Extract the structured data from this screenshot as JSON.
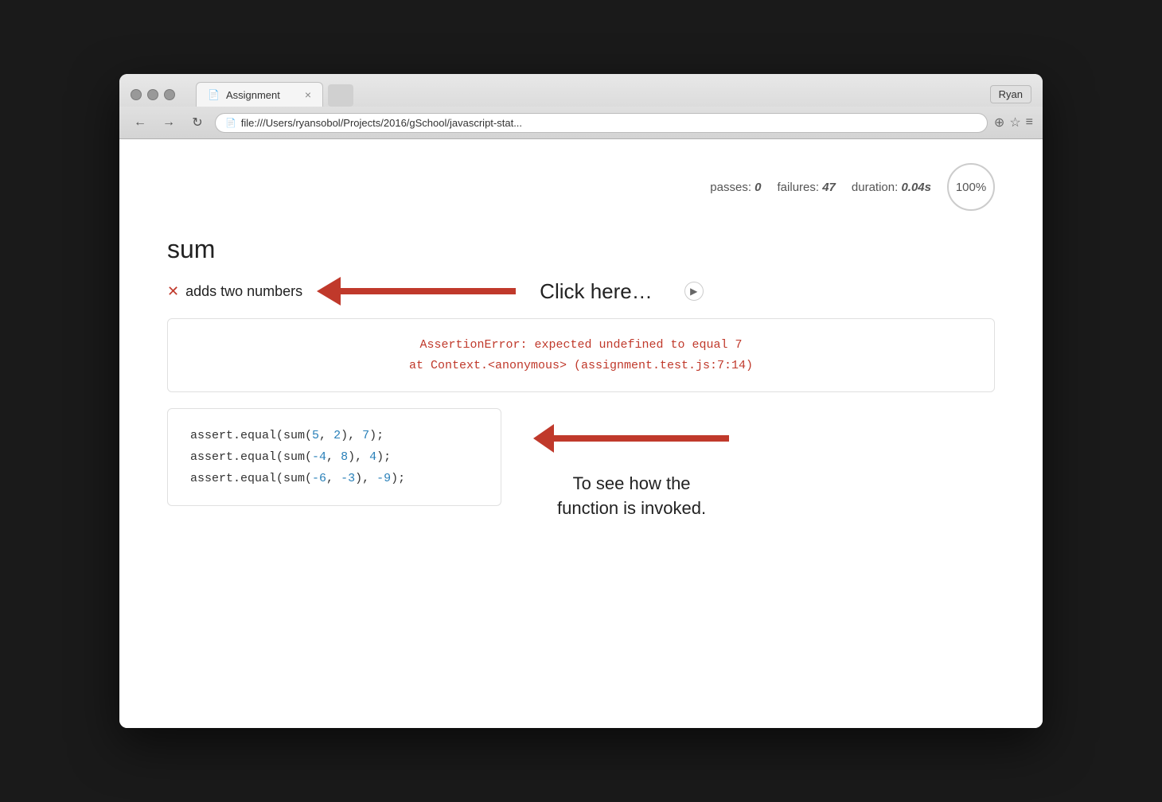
{
  "browser": {
    "tab_label": "Assignment",
    "tab_icon": "📄",
    "tab_close": "×",
    "new_tab_placeholder": "",
    "user_label": "Ryan",
    "back_icon": "←",
    "forward_icon": "→",
    "reload_icon": "↻",
    "address_icon": "📄",
    "address_url": "file:///Users/ryansobol/Projects/2016/gSchool/javascript-stat...",
    "zoom_icon": "⊕",
    "star_icon": "☆",
    "menu_icon": "≡"
  },
  "stats": {
    "passes_label": "passes:",
    "passes_value": "0",
    "failures_label": "failures:",
    "failures_value": "47",
    "duration_label": "duration:",
    "duration_value": "0.04",
    "duration_unit": "s",
    "progress_label": "100%"
  },
  "section": {
    "title": "sum"
  },
  "test_item": {
    "status_icon": "✕",
    "name": "adds two numbers",
    "expand_icon": "▶"
  },
  "annotation1": {
    "text": "Click here…"
  },
  "error": {
    "line1": "AssertionError: expected undefined to equal 7",
    "line2": "    at Context.<anonymous> (assignment.test.js:7:14)"
  },
  "code": {
    "line1": "assert.equal(sum(5, 2), 7);",
    "line1_parts": {
      "prefix": "assert.equal(sum(",
      "n1": "5",
      "sep1": ", ",
      "n2": "2",
      "suffix1": "), ",
      "n3": "7",
      "suffix2": ");"
    },
    "line2": "assert.equal(sum(-4, 8), 4);",
    "line2_parts": {
      "prefix": "assert.equal(sum(",
      "n1": "-4",
      "sep1": ", ",
      "n2": "8",
      "suffix1": "), ",
      "n3": "4",
      "suffix2": ");"
    },
    "line3": "assert.equal(sum(-6, -3), -9);",
    "line3_parts": {
      "prefix": "assert.equal(sum(",
      "n1": "-6",
      "sep1": ", ",
      "n2": "-3",
      "suffix1": "), ",
      "n3": "-9",
      "suffix2": ");"
    }
  },
  "annotation2": {
    "text": "To see how the\nfunction is invoked."
  },
  "colors": {
    "red": "#c0392b",
    "blue": "#2980b9",
    "text_dark": "#222222",
    "border": "#e0e0e0"
  }
}
